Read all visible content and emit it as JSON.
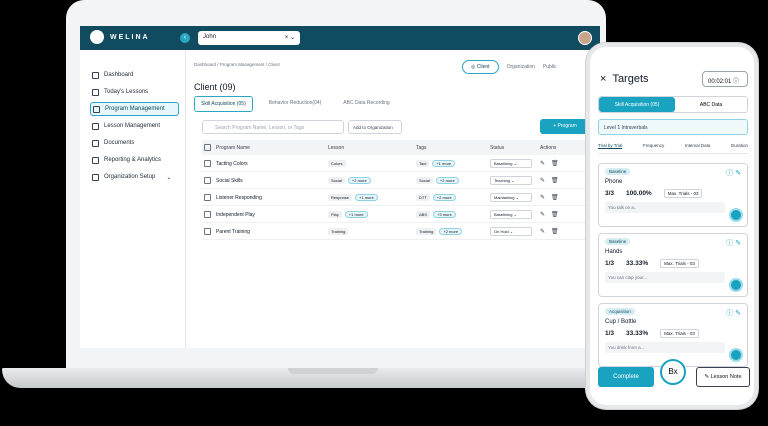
{
  "app": {
    "name": "WELINA"
  },
  "header": {
    "client_select": "John",
    "clear_icon": "×",
    "chevron": "⌄"
  },
  "sidebar": {
    "items": [
      {
        "label": "Dashboard"
      },
      {
        "label": "Today's Lessons"
      },
      {
        "label": "Program Management",
        "active": true
      },
      {
        "label": "Lesson Management"
      },
      {
        "label": "Documents"
      },
      {
        "label": "Reporting & Analytics"
      },
      {
        "label": "Organization Setup"
      }
    ]
  },
  "main": {
    "breadcrumb": "Dashboard / Program Management / Client",
    "scope_tabs": [
      "Client",
      "Organization",
      "Public"
    ],
    "title": "Client (09)",
    "program_tabs": [
      "Skill Acquisition (05)",
      "Behavior Reduction(04)",
      "ABC Data Recording"
    ],
    "search_placeholder": "Search Program Name, Lesson, or Tags",
    "add_org": "Add to Organization",
    "add_program": "+ Program",
    "columns": [
      "Program Name",
      "Lesson",
      "Tags",
      "Status",
      "Actions"
    ],
    "rows": [
      {
        "name": "Tacting Colors",
        "lesson": "Colors",
        "lesson_more": "",
        "tag": "Tact",
        "tag_more": "+1 more",
        "status": "Baselining"
      },
      {
        "name": "Social Skills",
        "lesson": "Social",
        "lesson_more": "+2 more",
        "tag": "Social",
        "tag_more": "+2 more",
        "status": "Teaching"
      },
      {
        "name": "Listener Responding",
        "lesson": "Response",
        "lesson_more": "+1 more",
        "tag": "DTT",
        "tag_more": "+2 more",
        "status": "Maintaining"
      },
      {
        "name": "Independent Play",
        "lesson": "Play",
        "lesson_more": "+1 more",
        "tag": "ABS",
        "tag_more": "+3 more",
        "status": "Baselining"
      },
      {
        "name": "Parent Training",
        "lesson": "Training",
        "lesson_more": "",
        "tag": "Training",
        "tag_more": "+2 more",
        "status": "On Hold"
      }
    ]
  },
  "phone": {
    "title": "Targets",
    "timer": "00:02:01",
    "tab_skill": "Skill Acquisition (05)",
    "tab_abc": "ABC Data",
    "level": "Level 1 Intraverbals",
    "modes": [
      "Trial by Trial",
      "Frequency",
      "Interval Data",
      "Duration"
    ],
    "cards": [
      {
        "badge": "Baseline",
        "name": "Phone",
        "ratio": "3/3",
        "pct": "100.00%",
        "max": "Max. Trials - 03",
        "note": "You talk on a.."
      },
      {
        "badge": "Baseline",
        "name": "Hands",
        "ratio": "1/3",
        "pct": "33.33%",
        "max": "Max. Trials - 03",
        "note": "You can clap your..."
      },
      {
        "badge": "Acquisition",
        "name": "Cup / Bottle",
        "ratio": "1/3",
        "pct": "33.33%",
        "max": "Max. Trials - 03",
        "note": "You drink from a..."
      }
    ],
    "complete": "Complete",
    "bx": "Bx",
    "lesson_note": "Lesson Note"
  }
}
